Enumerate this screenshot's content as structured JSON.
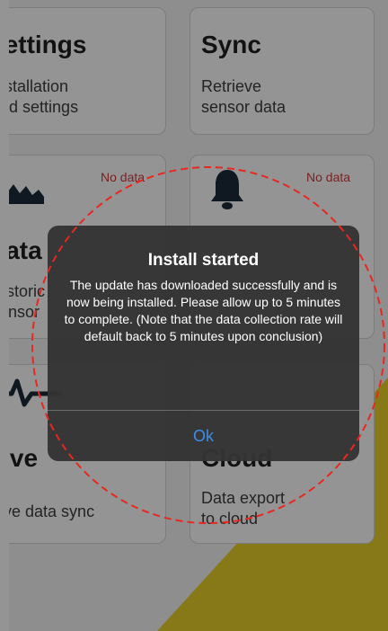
{
  "cards": {
    "settings": {
      "title": "Settings",
      "subtitle": "Installation\nand settings"
    },
    "sync": {
      "title": "Sync",
      "subtitle": "Retrieve\nsensor data"
    },
    "data": {
      "title": "Data",
      "subtitle": "Historic\nsensor",
      "status": "No data"
    },
    "alerts": {
      "status": "No data"
    },
    "live": {
      "title": "Live",
      "subtitle": "Live data sync"
    },
    "cloud": {
      "title": "Cloud",
      "subtitle": "Data export\nto cloud"
    }
  },
  "dialog": {
    "title": "Install started",
    "message": "The update has downloaded successfully and is now being installed.  Please allow up to 5 minutes to complete.  (Note that the data collection rate will default back to 5 minutes upon conclusion)",
    "ok_label": "Ok"
  },
  "colors": {
    "status_red": "#d33a3a",
    "button_blue": "#3c8fe8",
    "annotation_red": "#e8281f",
    "accent_yellow": "#e8cf2a"
  }
}
